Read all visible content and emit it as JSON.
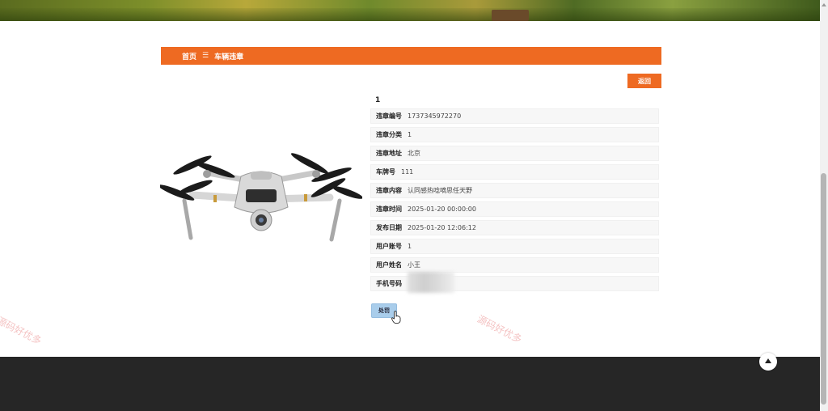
{
  "breadcrumb": {
    "home": "首页",
    "separator": "☰",
    "current": "车辆违章"
  },
  "back_label": "返回",
  "detail": {
    "title": "1",
    "fields": [
      {
        "label": "违章编号",
        "value": "1737345972270"
      },
      {
        "label": "违章分类",
        "value": "1"
      },
      {
        "label": "违章地址",
        "value": "北京"
      },
      {
        "label": "车牌号",
        "value": "111"
      },
      {
        "label": "违章内容",
        "value": "认同感热唸嘀思任天野"
      },
      {
        "label": "违章时间",
        "value": "2025-01-20 00:00:00"
      },
      {
        "label": "发布日期",
        "value": "2025-01-20 12:06:12"
      },
      {
        "label": "用户账号",
        "value": "1"
      },
      {
        "label": "用户姓名",
        "value": "小王"
      },
      {
        "label": "手机号码",
        "value": ""
      }
    ]
  },
  "handle_label": "处罚",
  "watermark": "源码好优多",
  "colors": {
    "accent": "#ee6a22",
    "button_blue": "#a9cdeb",
    "footer": "#262626"
  },
  "icons": {
    "back_to_top": "arrow-up-icon",
    "cursor": "hand-pointer-icon"
  }
}
